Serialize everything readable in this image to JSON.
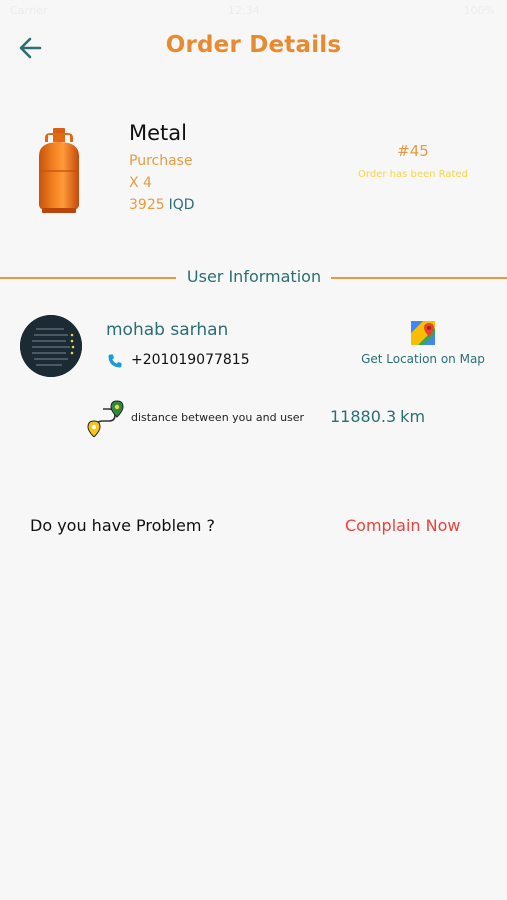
{
  "status_bar": {
    "time": "12:34",
    "carrier": "Carrier",
    "battery": "100%"
  },
  "header": {
    "title": "Order Details"
  },
  "product": {
    "name": "Metal",
    "type": "Purchase",
    "quantity": "X 4",
    "price": "3925",
    "currency": "IQD",
    "image_icon": "gas-cylinder"
  },
  "order": {
    "number": "#45",
    "status": "Order has been Rated"
  },
  "section": {
    "title": "User Information"
  },
  "user": {
    "name": "mohab sarhan",
    "phone": "+201019077815",
    "map_link": "Get Location on Map"
  },
  "distance": {
    "label": "distance between you and user",
    "value": "11880.3",
    "unit": "km"
  },
  "problem": {
    "question": "Do you have Problem ?",
    "action": "Complain Now"
  },
  "colors": {
    "accent": "#e88a2f",
    "teal": "#2b6f73",
    "alert": "#e8433a",
    "rated": "#f5d54a",
    "background": "#f7f7f7"
  }
}
